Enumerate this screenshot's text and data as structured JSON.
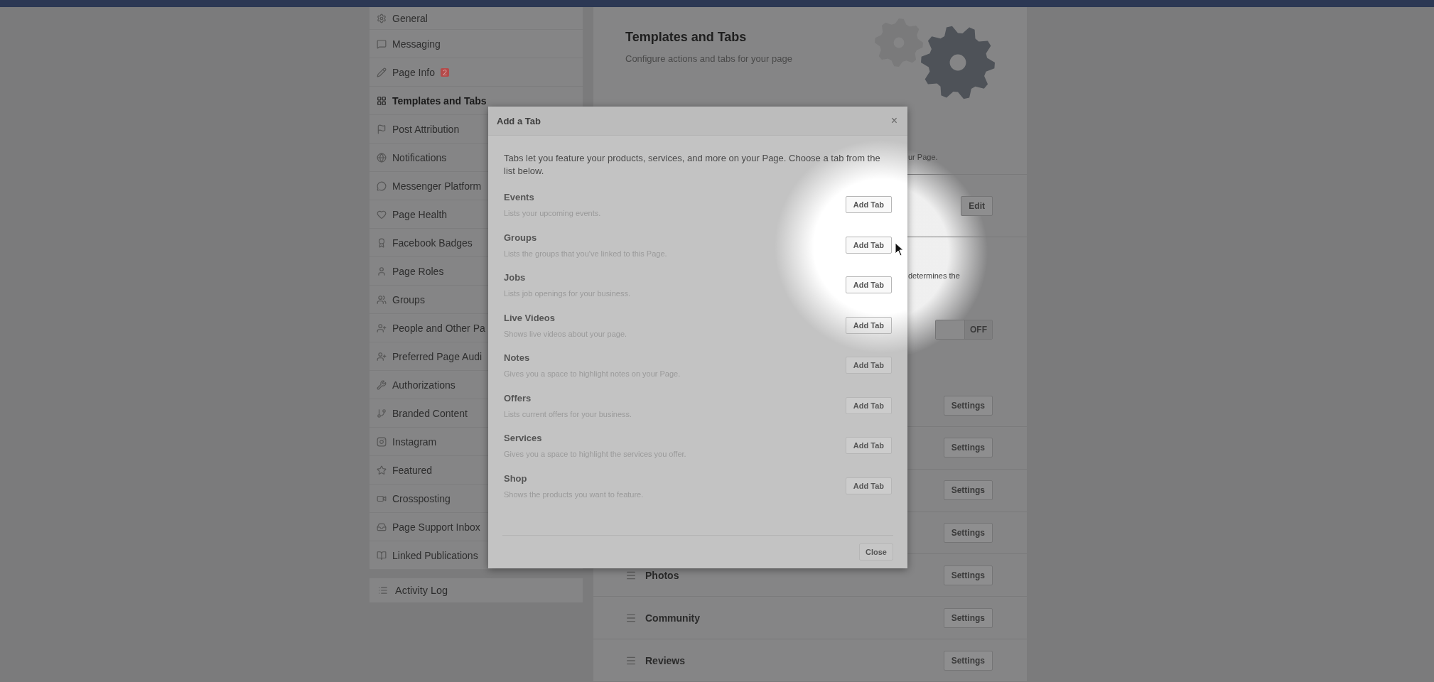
{
  "sidebar": {
    "items": [
      {
        "label": "General",
        "selected": false
      },
      {
        "label": "Messaging",
        "selected": false
      },
      {
        "label": "Page Info",
        "selected": false,
        "badge": "2"
      },
      {
        "label": "Templates and Tabs",
        "selected": true
      },
      {
        "label": "Post Attribution",
        "selected": false
      },
      {
        "label": "Notifications",
        "selected": false
      },
      {
        "label": "Messenger Platform",
        "selected": false
      },
      {
        "label": "Page Health",
        "selected": false
      },
      {
        "label": "Facebook Badges",
        "selected": false
      },
      {
        "label": "Page Roles",
        "selected": false
      },
      {
        "label": "Groups",
        "selected": false
      },
      {
        "label": "People and Other Pa",
        "selected": false
      },
      {
        "label": "Preferred Page Audi",
        "selected": false
      },
      {
        "label": "Authorizations",
        "selected": false
      },
      {
        "label": "Branded Content",
        "selected": false
      },
      {
        "label": "Instagram",
        "selected": false
      },
      {
        "label": "Featured",
        "selected": false
      },
      {
        "label": "Crossposting",
        "selected": false
      },
      {
        "label": "Page Support Inbox",
        "selected": false
      },
      {
        "label": "Linked Publications",
        "selected": false
      }
    ],
    "activity_log": {
      "label": "Activity Log"
    }
  },
  "main": {
    "title": "Templates and Tabs",
    "subtitle": "Configure actions and tabs for your page",
    "texts": [
      {
        "text": "ur Page."
      },
      {
        "text": "determines the"
      }
    ],
    "edit_button": "Edit",
    "toggle": {
      "label": "OFF",
      "on": false
    },
    "tab_rows": [
      {
        "settings": "Settings"
      },
      {
        "settings": "Settings"
      },
      {
        "settings": "Settings"
      },
      {
        "settings": "Settings"
      },
      {
        "label": "Photos",
        "settings": "Settings"
      },
      {
        "label": "Community",
        "settings": "Settings"
      },
      {
        "label": "Reviews",
        "settings": "Settings"
      }
    ]
  },
  "dialog": {
    "title": "Add a Tab",
    "close_icon": "×",
    "intro": "Tabs let you feature your products, services, and more on your Page. Choose a tab from the list below.",
    "tabs": [
      {
        "name": "Events",
        "description": "Lists your upcoming events.",
        "button": "Add Tab"
      },
      {
        "name": "Groups",
        "description": "Lists the groups that you've linked to this Page.",
        "button": "Add Tab"
      },
      {
        "name": "Jobs",
        "description": "Lists job openings for your business.",
        "button": "Add Tab"
      },
      {
        "name": "Live Videos",
        "description": "Shows live videos about your page.",
        "button": "Add Tab"
      },
      {
        "name": "Notes",
        "description": "Gives you a space to highlight notes on your Page.",
        "button": "Add Tab"
      },
      {
        "name": "Offers",
        "description": "Lists current offers for your business.",
        "button": "Add Tab"
      },
      {
        "name": "Services",
        "description": "Gives you a space to highlight the services you offer.",
        "button": "Add Tab"
      },
      {
        "name": "Shop",
        "description": "Shows the products you want to feature.",
        "button": "Add Tab"
      }
    ],
    "close_button": "Close"
  }
}
